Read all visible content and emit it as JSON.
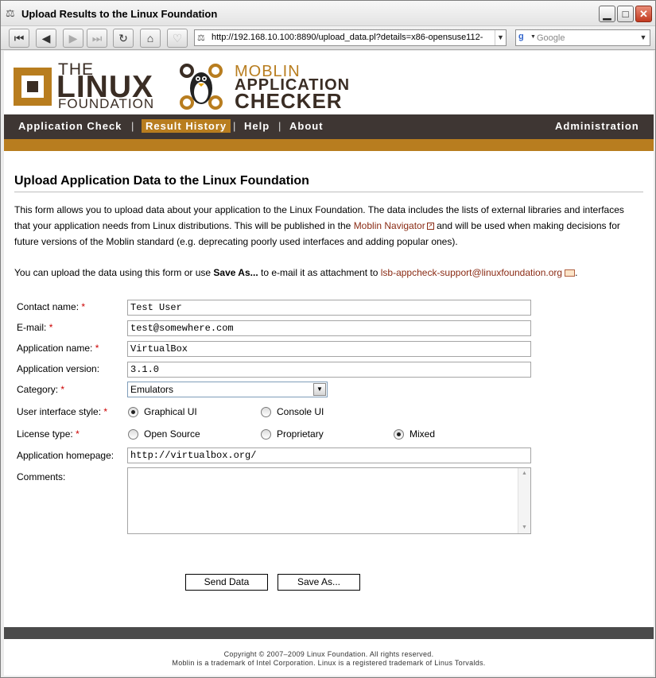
{
  "window": {
    "title": "Upload Results to the Linux Foundation",
    "minimize_glyph": "▁",
    "maximize_glyph": "□",
    "close_glyph": "✕"
  },
  "browser": {
    "url": "http://192.168.10.100:8890/upload_data.pl?details=x86-opensuse112-",
    "search_placeholder": "Google",
    "search_engine_glyph": "g"
  },
  "header": {
    "lf_the": "THE",
    "lf_linux": "LINUX",
    "lf_foundation": "FOUNDATION",
    "moblin_1": "MOBLIN",
    "moblin_2": "APPLICATION",
    "moblin_3": "CHECKER"
  },
  "nav": {
    "items": [
      "Application Check",
      "Result History",
      "Help",
      "About"
    ],
    "active": "Result History",
    "admin": "Administration",
    "separator": "|"
  },
  "page": {
    "title": "Upload Application Data to the Linux Foundation",
    "intro_before_link": "This form allows you to upload data about your application to the Linux Foundation. The data includes the lists of external libraries and interfaces that your application needs from Linux distributions. This will be published in the ",
    "intro_link": "Moblin Navigator",
    "intro_after_link": " and will be used when making decisions for future versions of the Moblin standard (e.g. deprecating poorly used interfaces and adding popular ones).",
    "upload_before": "You can upload the data using this form or use ",
    "upload_bold": "Save As...",
    "upload_middle": " to e-mail it as attachment to ",
    "upload_email": "lsb-appcheck-support@linuxfoundation.org",
    "upload_end": "."
  },
  "form": {
    "contact_label": "Contact name:",
    "contact_value": "Test User",
    "email_label": "E-mail:",
    "email_value": "test@somewhere.com",
    "app_name_label": "Application name:",
    "app_name_value": "VirtualBox",
    "app_version_label": "Application version:",
    "app_version_value": "3.1.0",
    "category_label": "Category:",
    "category_value": "Emulators",
    "ui_style_label": "User interface style:",
    "ui_options": [
      "Graphical UI",
      "Console UI"
    ],
    "ui_selected": "Graphical UI",
    "license_label": "License type:",
    "license_options": [
      "Open Source",
      "Proprietary",
      "Mixed"
    ],
    "license_selected": "Mixed",
    "homepage_label": "Application homepage:",
    "homepage_value": "http://virtualbox.org/",
    "comments_label": "Comments:",
    "required_mark": "*",
    "send_button": "Send Data",
    "save_button": "Save As..."
  },
  "footer": {
    "line1": "Copyright © 2007–2009 Linux Foundation. All rights reserved.",
    "line2": "Moblin is a trademark of Intel Corporation. Linux is a registered trademark of Linus Torvalds."
  }
}
